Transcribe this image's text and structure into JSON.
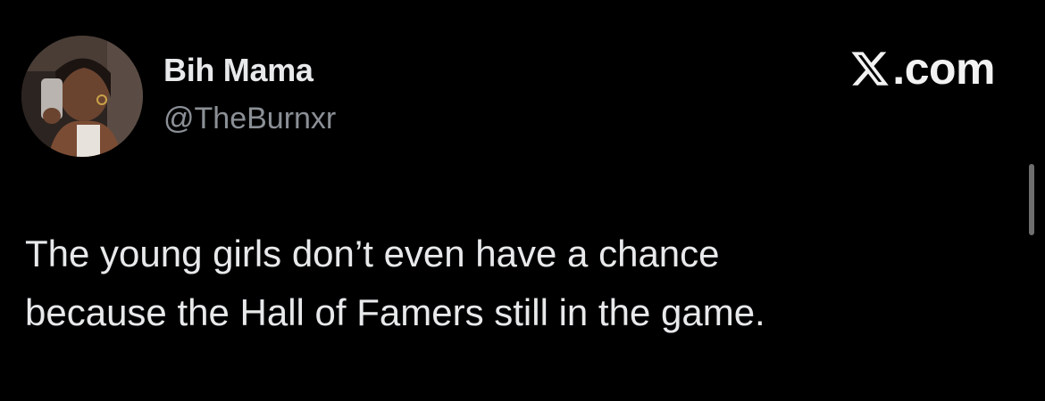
{
  "author": {
    "display_name": "Bih Mama",
    "handle": "@TheBurnxr"
  },
  "site_badge": {
    "icon": "x-logo-icon",
    "label": ".com"
  },
  "tweet": {
    "lines": [
      "The young girls don’t even have a chance",
      "because the Hall of Famers still in the game."
    ]
  },
  "colors": {
    "background": "#000000",
    "text": "#e7e9ea",
    "secondary_text": "#8b9096"
  }
}
